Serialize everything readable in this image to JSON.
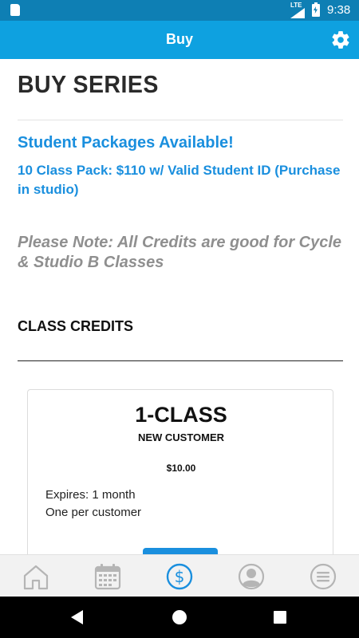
{
  "status_bar": {
    "network": "LTE",
    "time": "9:38"
  },
  "app_bar": {
    "title": "Buy",
    "settings_icon": "gear-icon"
  },
  "page": {
    "title": "BUY SERIES",
    "promo_heading": "Student Packages Available!",
    "promo_detail": "10 Class Pack: $110 w/ Valid Student ID (Purchase in studio)",
    "note": "Please Note: All Credits are good for Cycle & Studio B Classes",
    "section_heading": "CLASS CREDITS"
  },
  "card": {
    "title": "1-CLASS",
    "subtitle": "NEW CUSTOMER",
    "price": "$10.00",
    "expires": "Expires: 1 month",
    "limit": "One per customer"
  },
  "bottom_nav": {
    "items": [
      {
        "icon": "home-icon",
        "active": false
      },
      {
        "icon": "calendar-icon",
        "active": false
      },
      {
        "icon": "dollar-icon",
        "active": true
      },
      {
        "icon": "profile-icon",
        "active": false
      },
      {
        "icon": "menu-icon",
        "active": false
      }
    ]
  },
  "colors": {
    "status_bar": "#0e7fb4",
    "app_bar": "#0ea1e0",
    "accent_blue": "#1a8fde",
    "note_gray": "#8f8f8f",
    "nav_inactive": "#b5b5b5",
    "nav_active": "#1a8fde"
  }
}
